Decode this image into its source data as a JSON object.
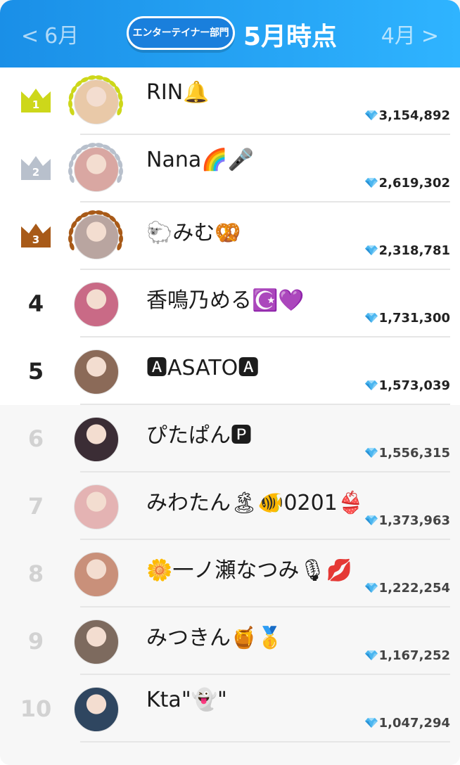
{
  "header": {
    "prev_label": "6月",
    "next_label": "4月",
    "category": "エンターテイナー部門",
    "period": "5月時点",
    "prev_chevron": "<",
    "next_chevron": ">"
  },
  "colors": {
    "header_start": "#1a8fe7",
    "header_end": "#2fb4ff",
    "gold": "#cdd71a",
    "silver": "#b8c0cc",
    "bronze": "#a85a18"
  },
  "ranking": [
    {
      "rank": "1",
      "name": "RIN🔔",
      "score": "3,154,892",
      "avatar_color": "#e9c9a8",
      "medal": "gold"
    },
    {
      "rank": "2",
      "name": "Nana🌈🎤",
      "score": "2,619,302",
      "avatar_color": "#d9a7a2",
      "medal": "silver"
    },
    {
      "rank": "3",
      "name": "🐑みむ🥨",
      "score": "2,318,781",
      "avatar_color": "#b9a5a0",
      "medal": "bronze"
    },
    {
      "rank": "4",
      "name": "香鳴乃める☪️💜",
      "score": "1,731,300",
      "avatar_color": "#c96a86",
      "medal": ""
    },
    {
      "rank": "5",
      "name": "🅰ASATO🅰",
      "score": "1,573,039",
      "avatar_color": "#8b6a58",
      "medal": ""
    },
    {
      "rank": "6",
      "name": "ぴたぱん🅿",
      "score": "1,556,315",
      "avatar_color": "#3b2d35",
      "medal": ""
    },
    {
      "rank": "7",
      "name": "みわたん🏝🐠0201👙",
      "score": "1,373,963",
      "avatar_color": "#e4b3b3",
      "medal": ""
    },
    {
      "rank": "8",
      "name": "🌼一ノ瀬なつみ🎙💋",
      "score": "1,222,254",
      "avatar_color": "#c9907a",
      "medal": ""
    },
    {
      "rank": "9",
      "name": "みつきん🍯🥇",
      "score": "1,167,252",
      "avatar_color": "#7d6a5e",
      "medal": ""
    },
    {
      "rank": "10",
      "name": "Kta\"👻\"",
      "score": "1,047,294",
      "avatar_color": "#2f4660",
      "medal": ""
    }
  ]
}
